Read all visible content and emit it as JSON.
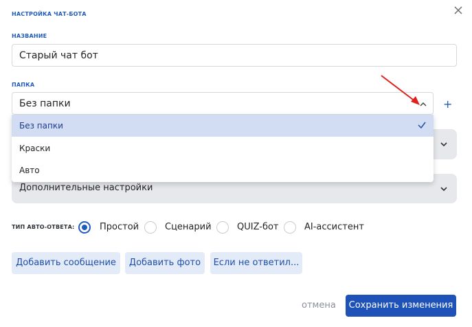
{
  "dialog": {
    "title": "настройка чат-бота",
    "close_icon": "close-icon"
  },
  "name_field": {
    "label": "название",
    "value": "Старый чат бот"
  },
  "folder_field": {
    "label": "папка",
    "value": "Без папки",
    "add_label": "+",
    "options": [
      {
        "label": "Без папки",
        "selected": true
      },
      {
        "label": "Краски",
        "selected": false
      },
      {
        "label": "Авто",
        "selected": false
      }
    ]
  },
  "additional_settings": {
    "label": "Дополнительные настройки"
  },
  "auto_reply": {
    "label": "тип авто-ответа:",
    "options": [
      {
        "label": "Простой",
        "selected": true
      },
      {
        "label": "Сценарий",
        "selected": false
      },
      {
        "label": "QUIZ-бот",
        "selected": false
      },
      {
        "label": "AI-ассистент",
        "selected": false
      }
    ]
  },
  "actions": {
    "add_message": "Добавить сообщение",
    "add_photo": "Добавить фото",
    "if_no_answer": "Если не ответил..."
  },
  "footer": {
    "cancel": "отмена",
    "save": "Сохранить изменения"
  },
  "colors": {
    "accent": "#1f52b8",
    "selected_row": "#d2dcf2",
    "soft_button": "#e4ebf8",
    "annotation_arrow": "#e0201c"
  }
}
